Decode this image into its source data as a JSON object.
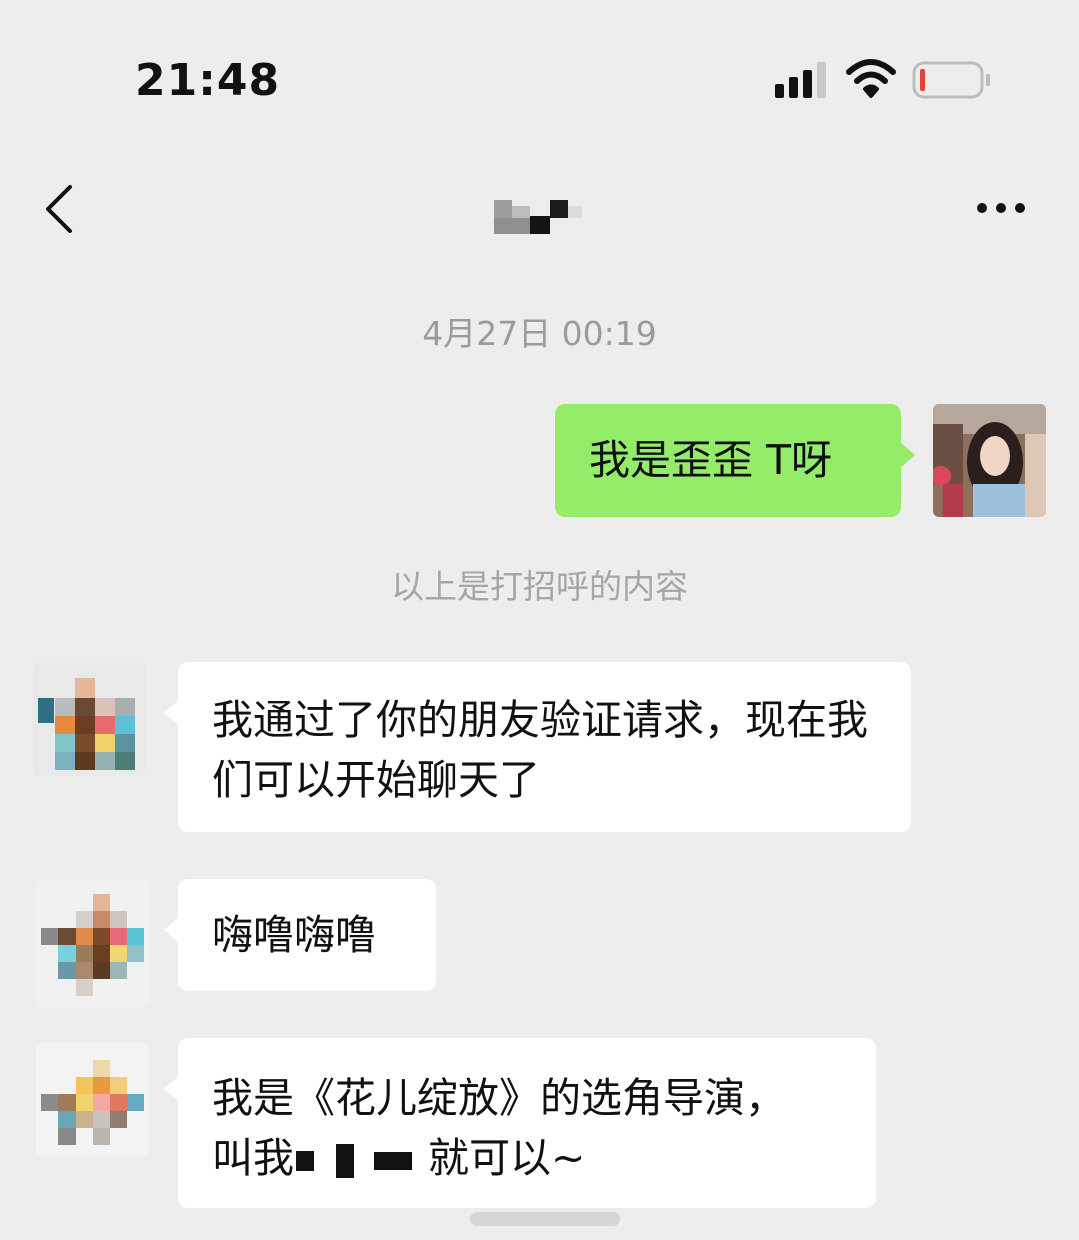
{
  "status_bar": {
    "time": "21:48",
    "signal_icon": "cellular-signal-icon",
    "wifi_icon": "wifi-icon",
    "battery_icon": "battery-low-icon",
    "battery_level": 0.06,
    "battery_color": "#e5413a"
  },
  "nav": {
    "back_icon": "chevron-left-icon",
    "more_icon": "more-dots-icon"
  },
  "chat": {
    "timestamp": "4月27日 00:19",
    "sent_message": "我是歪歪 T呀",
    "system_notice": "以上是打招呼的内容",
    "received_messages": [
      {
        "text": "我通过了你的朋友验证请求，现在我们可以开始聊天了"
      },
      {
        "text": "嗨噜嗨噜"
      },
      {
        "line1": "我是《花儿绽放》的选角导演，",
        "line2_prefix": "叫我",
        "line2_suffix": "就可以~"
      }
    ]
  },
  "colors": {
    "background": "#ededed",
    "sent_bubble": "#95ec69",
    "received_bubble": "#ffffff",
    "muted_text": "#9b9b9b"
  }
}
